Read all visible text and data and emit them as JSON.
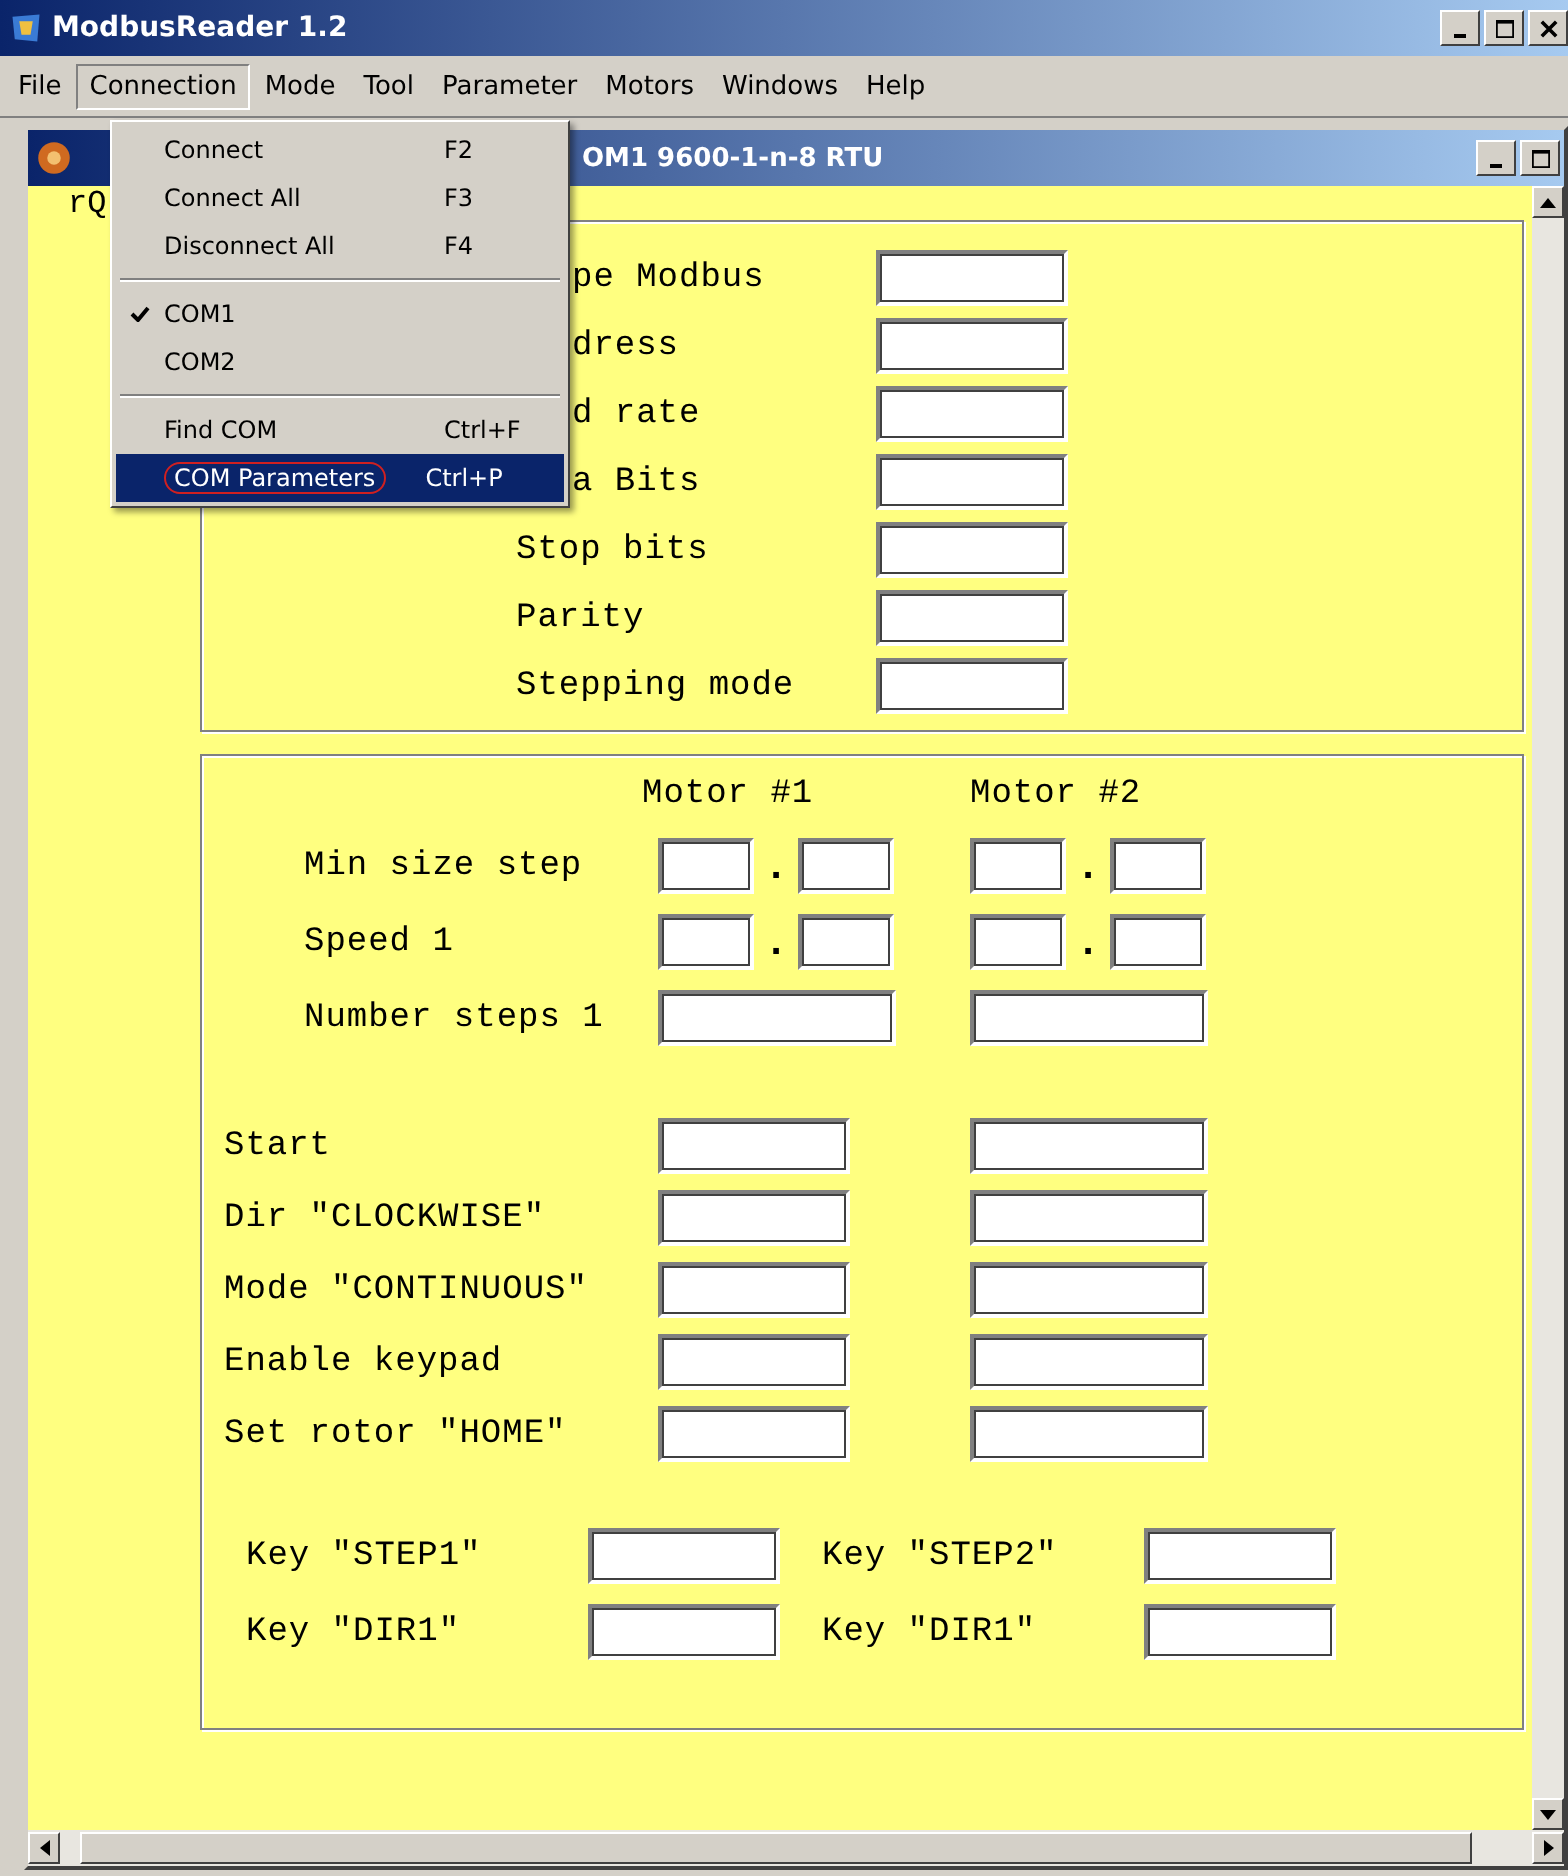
{
  "window": {
    "title": "ModbusReader 1.2"
  },
  "menubar": [
    {
      "label": "File",
      "selected": false
    },
    {
      "label": "Connection",
      "selected": true
    },
    {
      "label": "Mode",
      "selected": false
    },
    {
      "label": "Tool",
      "selected": false
    },
    {
      "label": "Parameter",
      "selected": false
    },
    {
      "label": "Motors",
      "selected": false
    },
    {
      "label": "Windows",
      "selected": false
    },
    {
      "label": "Help",
      "selected": false
    }
  ],
  "menu": {
    "groups": [
      [
        {
          "label": "Connect",
          "shortcut": "F2",
          "checked": false,
          "selected": false,
          "circled": false
        },
        {
          "label": "Connect All",
          "shortcut": "F3",
          "checked": false,
          "selected": false,
          "circled": false
        },
        {
          "label": "Disconnect All",
          "shortcut": "F4",
          "checked": false,
          "selected": false,
          "circled": false
        }
      ],
      [
        {
          "label": "COM1",
          "checked": true,
          "selected": false,
          "circled": false
        },
        {
          "label": "COM2",
          "checked": false,
          "selected": false,
          "circled": false
        }
      ],
      [
        {
          "label": "Find COM",
          "shortcut": "Ctrl+F",
          "checked": false,
          "selected": false,
          "circled": false
        },
        {
          "label": "COM Parameters",
          "shortcut": "Ctrl+P",
          "checked": false,
          "selected": true,
          "circled": true
        }
      ]
    ]
  },
  "child_window": {
    "title": "OM1  9600-1-n-8 RTU",
    "text": "rQ"
  },
  "settings": [
    {
      "label": "pe Modbus",
      "clipped": true
    },
    {
      "label": "dress",
      "clipped": true
    },
    {
      "label": "d rate",
      "clipped": true
    },
    {
      "label": "a Bits",
      "clipped": true
    },
    {
      "label": "Stop bits",
      "clipped": false
    },
    {
      "label": "Parity",
      "clipped": false
    },
    {
      "label": "Stepping mode",
      "clipped": false
    }
  ],
  "motors": {
    "headers": [
      "Motor #1",
      "Motor #2"
    ],
    "step_rows": [
      {
        "label": "Min size step",
        "kind": "split",
        "separators": [
          ".",
          "."
        ]
      },
      {
        "label": "Speed 1",
        "kind": "split",
        "separators": [
          ".",
          "."
        ]
      },
      {
        "label": "Number steps 1",
        "kind": "single"
      }
    ],
    "action_rows": [
      "Start",
      "Dir \"CLOCKWISE\"",
      "Mode \"CONTINUOUS\"",
      "Enable keypad",
      "Set rotor \"HOME\""
    ],
    "key_rows": [
      [
        "Key \"STEP1\"",
        "Key \"STEP2\""
      ],
      [
        "Key \"DIR1\"",
        "Key \"DIR1\""
      ]
    ]
  }
}
